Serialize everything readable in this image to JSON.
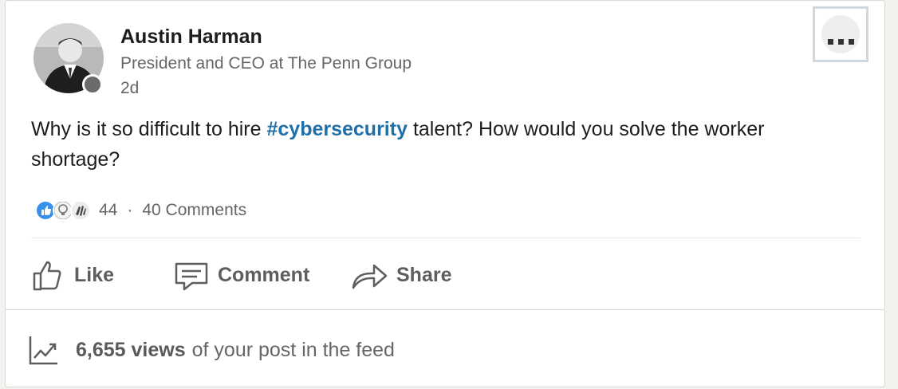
{
  "author": {
    "name": "Austin Harman",
    "headline": "President and CEO at The Penn Group",
    "time_ago": "2d",
    "avatar_icon": "profile-photo",
    "presence_status_color": "#6b6b6b"
  },
  "menu": {
    "icon": "more-horizontal-icon"
  },
  "post": {
    "text_before": "Why is it so difficult to hire ",
    "hashtag": "#cybersecurity",
    "text_after": " talent? How would you solve the worker shortage?",
    "hashtag_color": "#1f6fa8"
  },
  "social": {
    "reactions": [
      "like-reaction-icon",
      "insightful-reaction-icon",
      "celebrate-reaction-icon"
    ],
    "reaction_count": "44",
    "separator": "·",
    "comments": "40 Comments"
  },
  "actions": {
    "like": "Like",
    "comment": "Comment",
    "share": "Share"
  },
  "analytics": {
    "views": "6,655 views",
    "suffix": "of your post in the feed",
    "icon": "trending-chart-icon"
  }
}
